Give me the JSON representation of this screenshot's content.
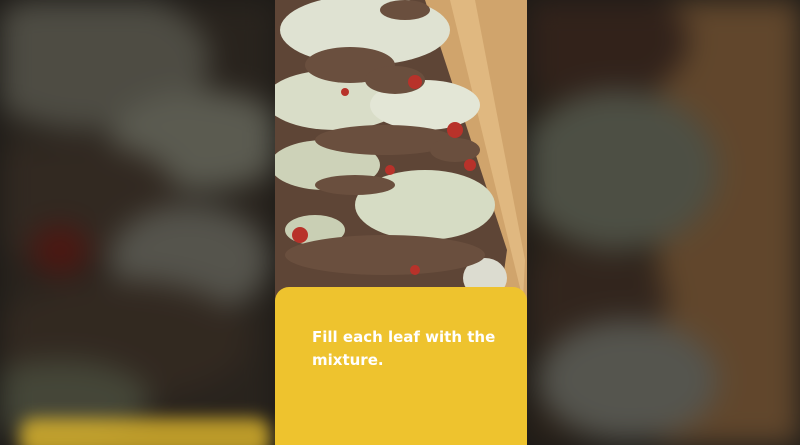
{
  "video": {
    "caption": "Fill each leaf with the mixture."
  },
  "colors": {
    "caption_background": "#eec32e",
    "caption_text": "#ffffff",
    "backdrop": "#1c1a17",
    "wood": "#c99a62",
    "cabbage": "#dfe3cf",
    "meat": "#6b5040",
    "tomato": "#b8322a"
  }
}
